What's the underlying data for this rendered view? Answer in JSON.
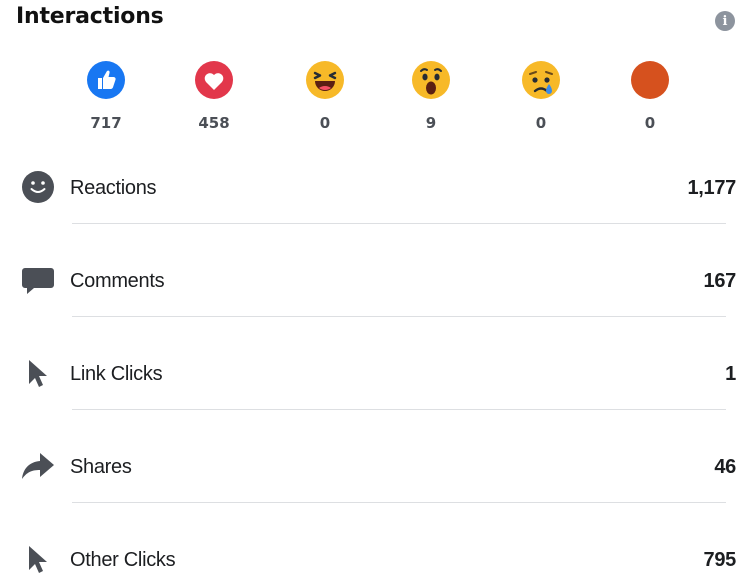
{
  "header": {
    "title": "Interactions",
    "info_icon": "info-icon"
  },
  "reactions": [
    {
      "name": "like",
      "icon": "like-reaction-icon",
      "count": "717",
      "color": "#1877f2"
    },
    {
      "name": "love",
      "icon": "love-reaction-icon",
      "count": "458",
      "color": "#f33e58"
    },
    {
      "name": "haha",
      "icon": "haha-reaction-icon",
      "count": "0",
      "color": "#f7b125"
    },
    {
      "name": "wow",
      "icon": "wow-reaction-icon",
      "count": "9",
      "color": "#f7b125"
    },
    {
      "name": "sad",
      "icon": "sad-reaction-icon",
      "count": "0",
      "color": "#f7b125"
    },
    {
      "name": "angry",
      "icon": "angry-reaction-icon",
      "count": "0",
      "color": "#e0541f"
    }
  ],
  "metrics": [
    {
      "icon": "smiley-face-icon",
      "label": "Reactions",
      "value": "1,177"
    },
    {
      "icon": "comment-icon",
      "label": "Comments",
      "value": "167"
    },
    {
      "icon": "cursor-icon",
      "label": "Link Clicks",
      "value": "1"
    },
    {
      "icon": "share-arrow-icon",
      "label": "Shares",
      "value": "46"
    },
    {
      "icon": "cursor-icon",
      "label": "Other Clicks",
      "value": "795"
    }
  ]
}
